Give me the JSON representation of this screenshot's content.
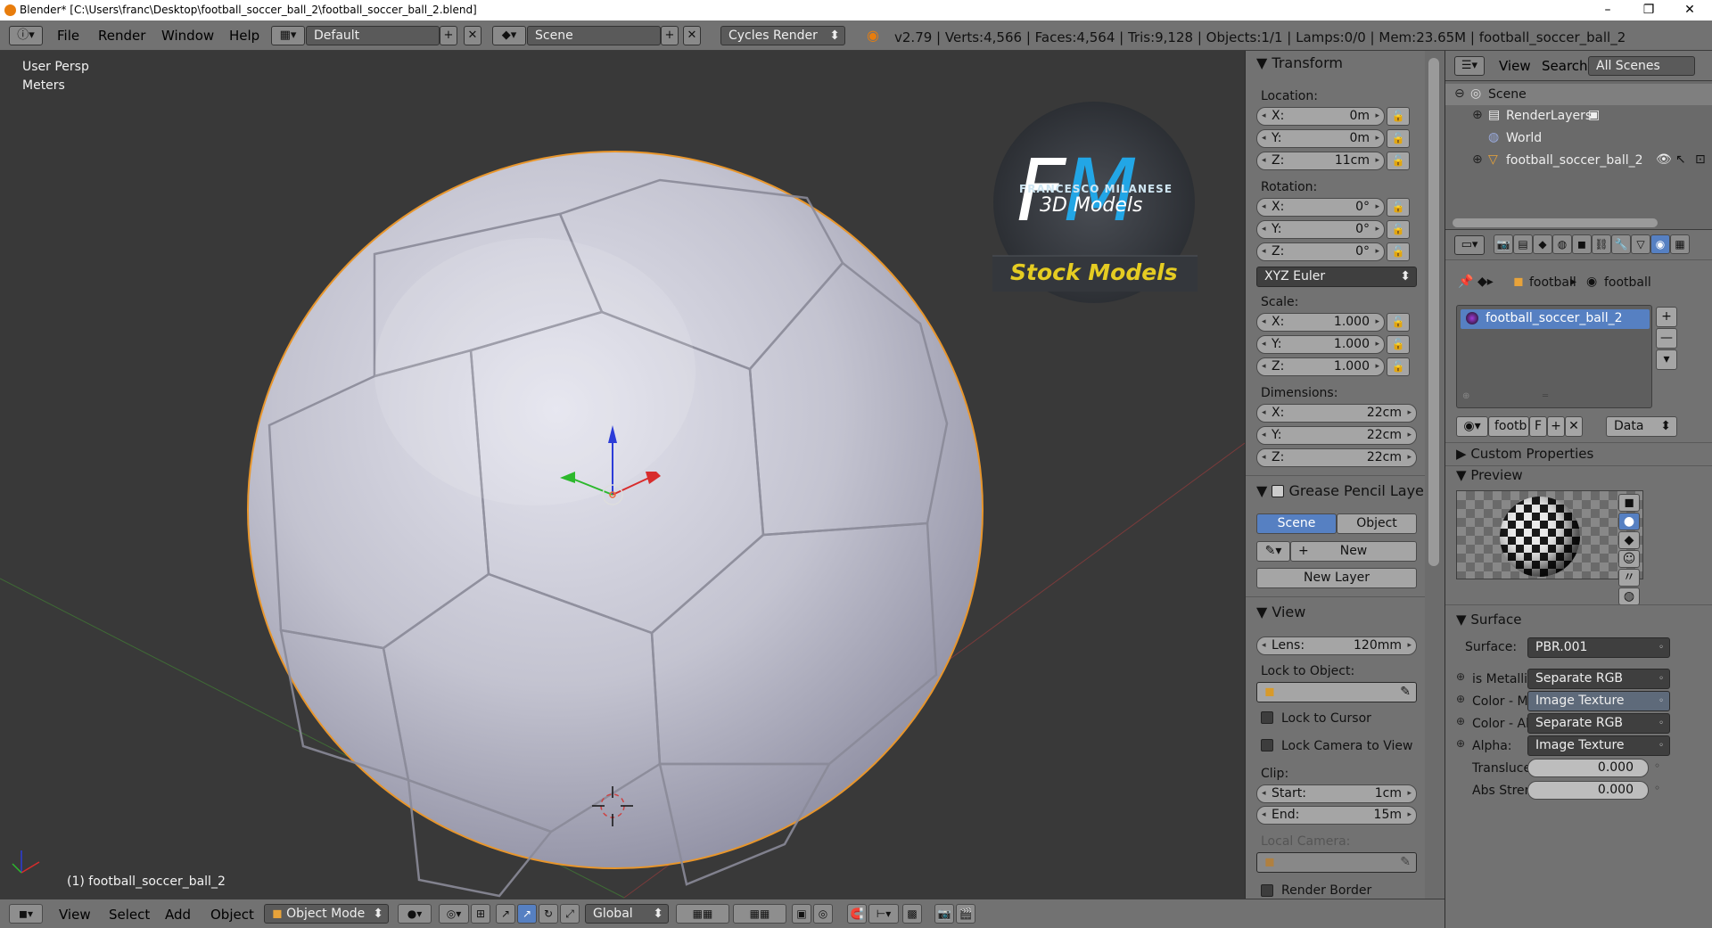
{
  "window": {
    "title": "Blender* [C:\\Users\\franc\\Desktop\\football_soccer_ball_2\\football_soccer_ball_2.blend]"
  },
  "menu": [
    "File",
    "Render",
    "Window",
    "Help"
  ],
  "layout": "Default",
  "scene": "Scene",
  "engine": "Cycles Render",
  "info": "v2.79 | Verts:4,566 | Faces:4,564 | Tris:9,128 | Objects:1/1 | Lamps:0/0 | Mem:23.65M | football_soccer_ball_2",
  "viewport": {
    "view": "User Persp",
    "units": "Meters",
    "object": "(1) football_soccer_ball_2"
  },
  "watermark": {
    "brand": "FRANCESCO MILANESE",
    "sub": "3D Models",
    "stock": "Stock Models"
  },
  "transform": {
    "title": "Transform",
    "location_label": "Location:",
    "location": [
      {
        "k": "X:",
        "v": "0m"
      },
      {
        "k": "Y:",
        "v": "0m"
      },
      {
        "k": "Z:",
        "v": "11cm"
      }
    ],
    "rotation_label": "Rotation:",
    "rotation": [
      {
        "k": "X:",
        "v": "0°"
      },
      {
        "k": "Y:",
        "v": "0°"
      },
      {
        "k": "Z:",
        "v": "0°"
      }
    ],
    "rotation_mode": "XYZ Euler",
    "scale_label": "Scale:",
    "scale": [
      {
        "k": "X:",
        "v": "1.000"
      },
      {
        "k": "Y:",
        "v": "1.000"
      },
      {
        "k": "Z:",
        "v": "1.000"
      }
    ],
    "dimensions_label": "Dimensions:",
    "dimensions": [
      {
        "k": "X:",
        "v": "22cm"
      },
      {
        "k": "Y:",
        "v": "22cm"
      },
      {
        "k": "Z:",
        "v": "22cm"
      }
    ]
  },
  "grease": {
    "title": "Grease Pencil Layer",
    "scene": "Scene",
    "object": "Object",
    "new": "New",
    "new_layer": "New Layer"
  },
  "view": {
    "title": "View",
    "lens_k": "Lens:",
    "lens_v": "120mm",
    "lock_obj": "Lock to Object:",
    "lock_cursor": "Lock to Cursor",
    "lock_camera": "Lock Camera to View",
    "clip": "Clip:",
    "start_k": "Start:",
    "start_v": "1cm",
    "end_k": "End:",
    "end_v": "15m",
    "local_camera": "Local Camera:",
    "render_border": "Render Border"
  },
  "outliner": {
    "view": "View",
    "search": "Search",
    "filter": "All Scenes",
    "items": [
      "Scene",
      "RenderLayers",
      "World",
      "football_soccer_ball_2"
    ]
  },
  "props": {
    "crumb1": "football",
    "crumb2": "football",
    "material": "football_soccer_ball_2",
    "mat_short": "footb",
    "mat_f": "F",
    "data": "Data",
    "custom": "Custom Properties",
    "preview": "Preview",
    "surface": "Surface",
    "surface_k": "Surface:",
    "surface_v": "PBR.001",
    "inputs": [
      {
        "k": "is Metallic",
        "v": "Separate RGB"
      },
      {
        "k": "Color - Ma",
        "v": "Image Texture"
      },
      {
        "k": "Color - Ab",
        "v": "Separate RGB"
      },
      {
        "k": "Alpha:",
        "v": "Image Texture"
      }
    ],
    "transl_k": "Transluce",
    "transl_v": "0.000",
    "abs_k": "Abs Stren",
    "abs_v": "0.000"
  },
  "bottom": {
    "menu": [
      "View",
      "Select",
      "Add",
      "Object"
    ],
    "mode": "Object Mode",
    "orientation": "Global"
  }
}
